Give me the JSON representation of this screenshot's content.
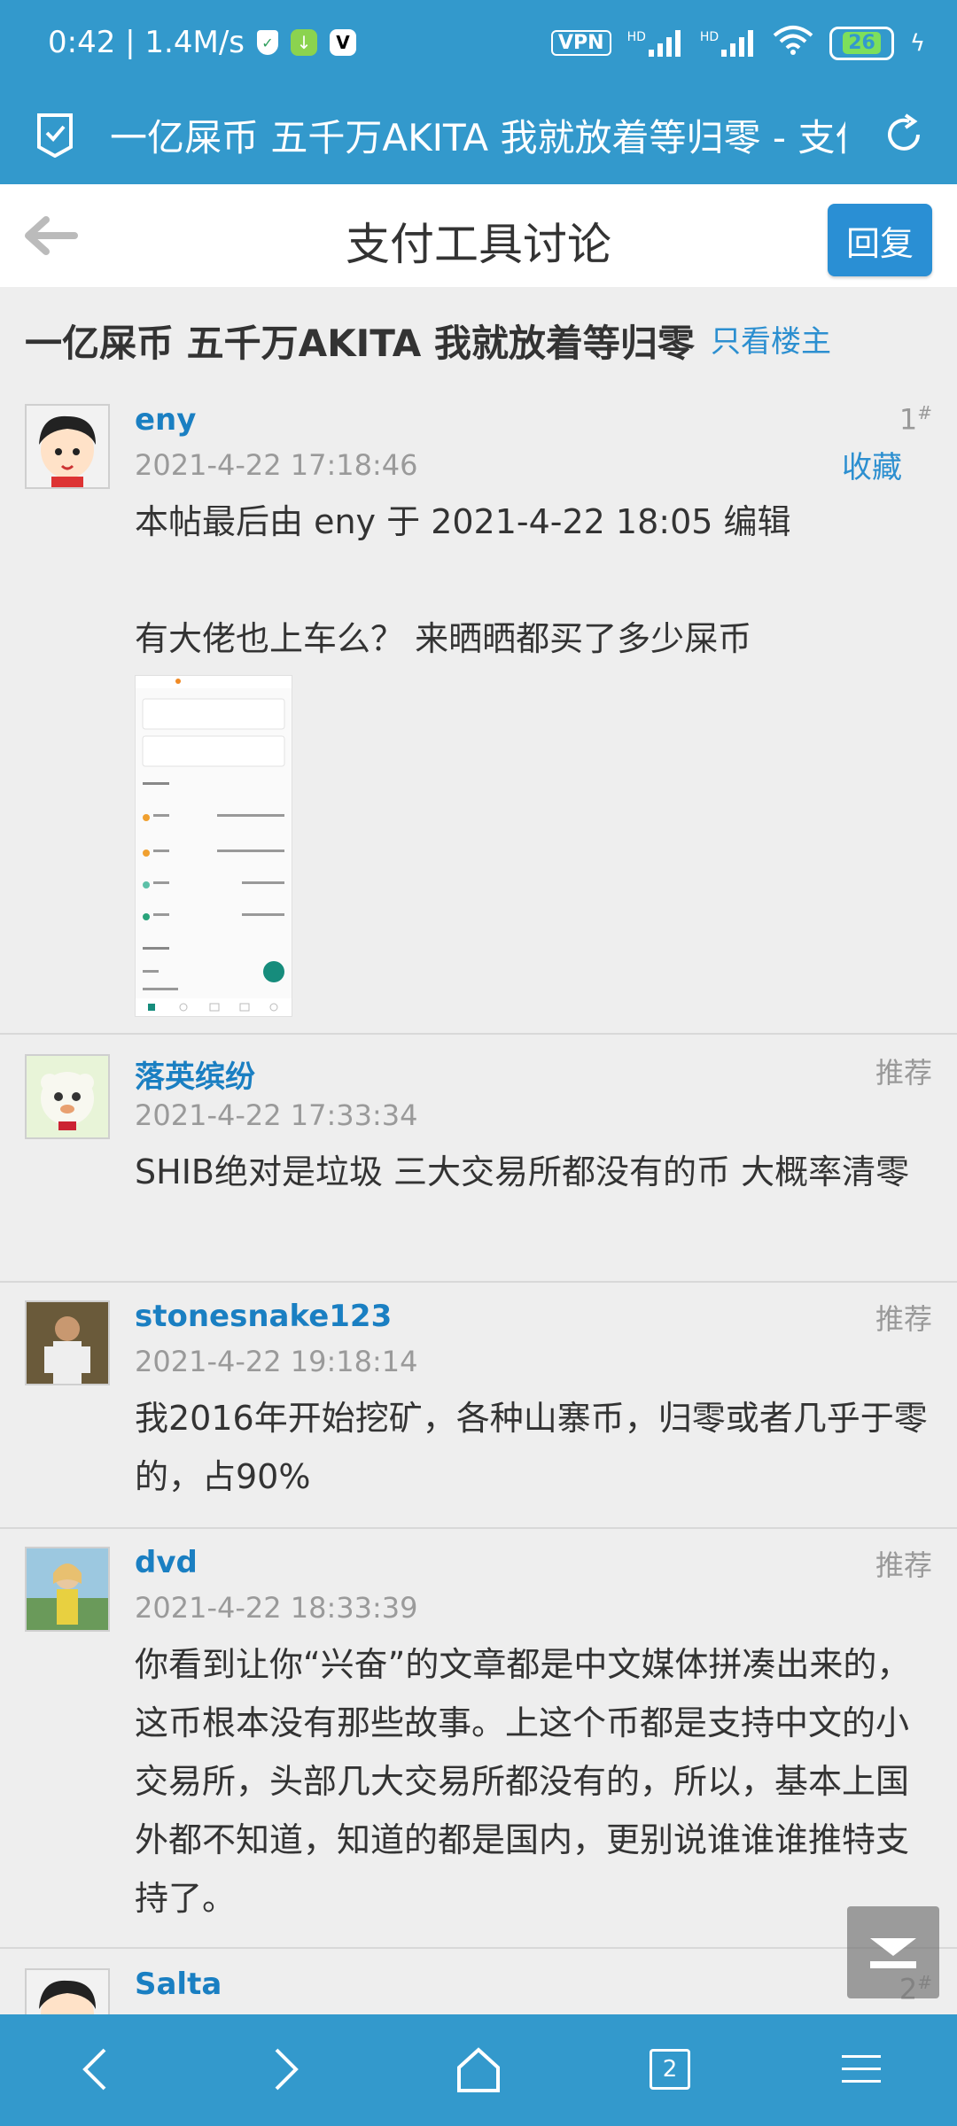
{
  "status_bar": {
    "time_speed": "0:42 | 1.4M/s",
    "vpn": "VPN",
    "signal1_label": "HD",
    "signal2_label": "HD",
    "battery": "26"
  },
  "url_bar": {
    "title": "一亿屎币 五千万AKITA 我就放着等归零 - 支付工具讨论"
  },
  "nav": {
    "title": "支付工具讨论",
    "reply": "回复"
  },
  "thread": {
    "title": "一亿屎币 五千万AKITA 我就放着等归零",
    "only_op": "只看楼主"
  },
  "posts": [
    {
      "author": "eny",
      "time": "2021-4-22 17:18:46",
      "floor": "1",
      "floor_mark": "#",
      "collect": "收藏",
      "edit_note": "本帖最后由 eny 于 2021-4-22 18:05 编辑",
      "text": "有大佬也上车么？ 来晒晒都买了多少屎币"
    },
    {
      "author": "落英缤纷",
      "time": "2021-4-22 17:33:34",
      "recommend": "推荐",
      "text": "SHIB绝对是垃圾 三大交易所都没有的币 大概率清零"
    },
    {
      "author": "stonesnake123",
      "time": "2021-4-22 19:18:14",
      "recommend": "推荐",
      "text": "我2016年开始挖矿，各种山寨币，归零或者几乎于零的，占90%"
    },
    {
      "author": "dvd",
      "time": "2021-4-22 18:33:39",
      "recommend": "推荐",
      "text": "你看到让你“兴奋”的文章都是中文媒体拼凑出来的，这币根本没有那些故事。上这个币都是支持中文的小交易所，头部几大交易所都没有的，所以，基本上国外都不知道，知道的都是国内，更别说谁谁谁推特支持了。"
    },
    {
      "author": "Salta",
      "floor": "2",
      "floor_mark": "#"
    }
  ],
  "bottom_bar": {
    "tab_count": "2"
  },
  "colors": {
    "brand": "#3399cc",
    "link": "#1a7fc2",
    "reply_button": "#2a8fd4"
  }
}
